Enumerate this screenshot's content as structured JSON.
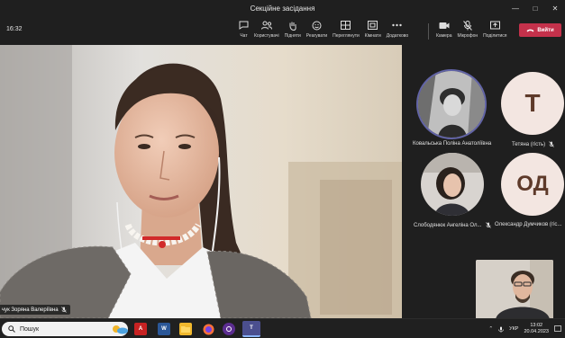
{
  "window": {
    "title": "Секційне засідання"
  },
  "toolbar": {
    "timer": "16:32",
    "items": [
      {
        "label": "Чат",
        "icon": "chat-icon"
      },
      {
        "label": "Користувачі",
        "icon": "people-icon"
      },
      {
        "label": "Підняти",
        "icon": "raise-hand-icon"
      },
      {
        "label": "Реагувати",
        "icon": "react-icon"
      },
      {
        "label": "Переглянути",
        "icon": "view-icon"
      },
      {
        "label": "Кімнати",
        "icon": "rooms-icon"
      },
      {
        "label": "Додатково",
        "icon": "more-icon"
      }
    ],
    "media": [
      {
        "label": "Камера",
        "icon": "camera-icon"
      },
      {
        "label": "Мікрофон",
        "icon": "mic-off-icon"
      },
      {
        "label": "Поділитися",
        "icon": "share-icon"
      }
    ],
    "leave_label": "Вийти"
  },
  "stage": {
    "speaker_name": "чук Зоряна Валеріївна"
  },
  "gallery": {
    "participants": [
      {
        "name": "Ковальська Поліна Анатоліївна",
        "initials": ""
      },
      {
        "name": "Тетяна (гість)",
        "initials": "Т"
      },
      {
        "name": "Слободянюк Ангеліна Ол...",
        "initials": ""
      },
      {
        "name": "Олександр Думчиков (гіс...",
        "initials": "ОД"
      }
    ]
  },
  "taskbar": {
    "search_placeholder": "Пошук",
    "language": "УКР",
    "time": "13:02",
    "date": "20.04.2023"
  },
  "colors": {
    "leave": "#c4314b",
    "accent_ring": "#6264a7",
    "avatar_bg": "#f3e6e1",
    "avatar_text": "#5e3a2a"
  }
}
